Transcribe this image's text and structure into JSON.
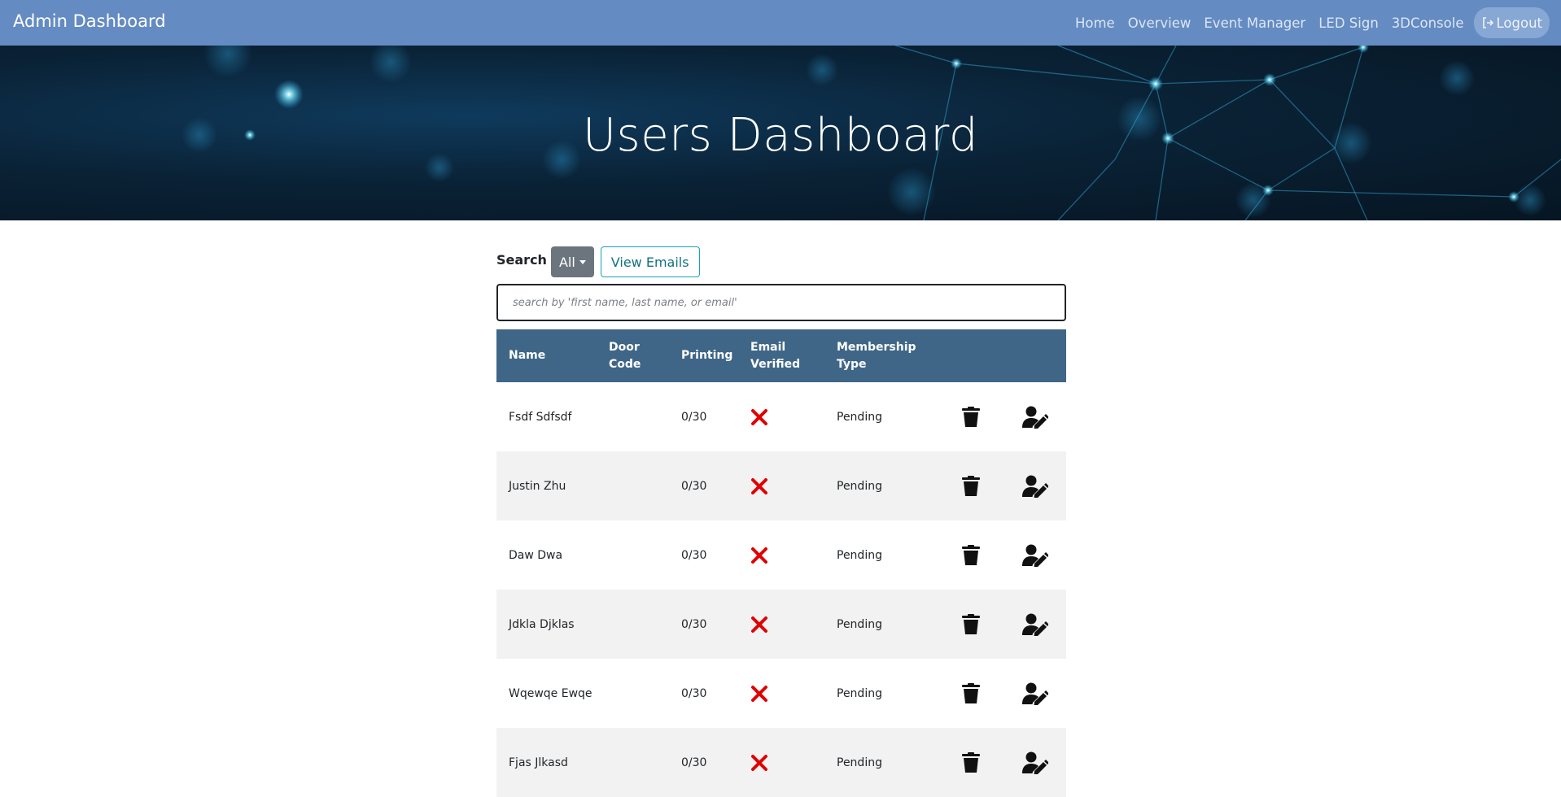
{
  "navbar": {
    "brand": "Admin Dashboard",
    "links": [
      "Home",
      "Overview",
      "Event Manager",
      "LED Sign",
      "3DConsole"
    ],
    "logout_label": "Logout",
    "background_color": "#648bc2"
  },
  "hero": {
    "title": "Users Dashboard"
  },
  "search": {
    "label": "Search",
    "filter_selected": "All",
    "view_emails_label": "View Emails",
    "placeholder": "search by 'first name, last name, or email'",
    "value": ""
  },
  "table": {
    "header_color": "#3f6687",
    "columns": [
      {
        "line1": "Name",
        "line2": ""
      },
      {
        "line1": "Door",
        "line2": "Code"
      },
      {
        "line1": "Printing",
        "line2": ""
      },
      {
        "line1": "Email",
        "line2": "Verified"
      },
      {
        "line1": "Membership",
        "line2": "Type"
      }
    ],
    "rows": [
      {
        "name": "Fsdf Sdfsdf",
        "door_code": "",
        "printing": "0/30",
        "email_verified": "x-icon",
        "membership": "Pending"
      },
      {
        "name": "Justin Zhu",
        "door_code": "",
        "printing": "0/30",
        "email_verified": "x-icon",
        "membership": "Pending"
      },
      {
        "name": "Daw Dwa",
        "door_code": "",
        "printing": "0/30",
        "email_verified": "x-icon",
        "membership": "Pending"
      },
      {
        "name": "Jdkla Djklas",
        "door_code": "",
        "printing": "0/30",
        "email_verified": "x-icon",
        "membership": "Pending"
      },
      {
        "name": "Wqewqe Ewqe",
        "door_code": "",
        "printing": "0/30",
        "email_verified": "x-icon",
        "membership": "Pending"
      },
      {
        "name": "Fjas Jlkasd",
        "door_code": "",
        "printing": "0/30",
        "email_verified": "x-icon",
        "membership": "Pending"
      }
    ],
    "row_actions": [
      "trash-icon",
      "user-edit-icon"
    ],
    "unverified_color": "#e00000"
  }
}
